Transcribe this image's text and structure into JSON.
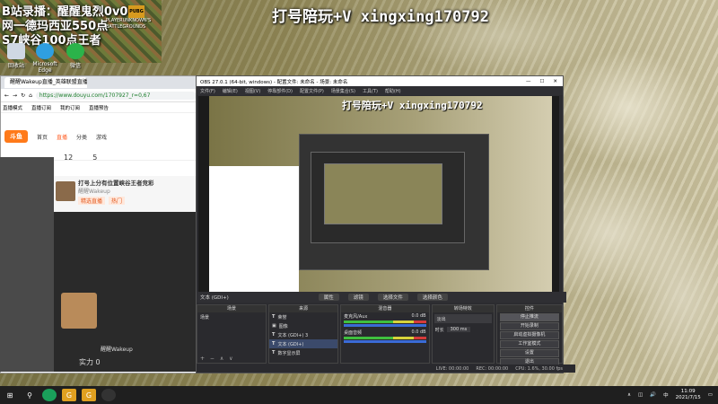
{
  "overlay": {
    "line1": "B站录播：醒醒鬼烈0v0",
    "line2": "网一德玛西亚550点",
    "line3": "S7峡谷100点王者",
    "banner": "打号陪玩+V xingxing170792"
  },
  "desktop_icons": [
    {
      "label": "回收站",
      "icon": "recycle-bin-icon"
    },
    {
      "label": "Microsoft Edge",
      "icon": "edge-icon"
    },
    {
      "label": "微信",
      "icon": "wechat-icon"
    }
  ],
  "pubg": {
    "badge": "PUBG",
    "sub1": "PLAYERUNKNOWN'S",
    "sub2": "BATTLEGROUNDS"
  },
  "browser": {
    "tab_title": "醒醒Wakeup直播_英雄联盟直播",
    "url": "https://www.douyu.com/1707927_r=0,67",
    "bookmarks": [
      "直播模式",
      "直播订阅",
      "我的订阅",
      "直播预告"
    ],
    "nav": [
      "首页",
      "直播",
      "分类",
      "游戏"
    ],
    "room_title": "打号上分有位置峡谷王者竞彩",
    "streamer": "醒醒Wakeup",
    "stats": [
      {
        "value": "12"
      },
      {
        "value": "5"
      }
    ],
    "tags": [
      "精选直播",
      "热门"
    ],
    "chat_name": "醒醒Wakeup",
    "bottom_value": "实力 0"
  },
  "obs": {
    "title": "OBS 27.0.1 (64-bit, windows) - 配置文件: 未命名 - 场景: 未命名",
    "menu": [
      "文件(F)",
      "编辑(E)",
      "视图(V)",
      "停靠部件(D)",
      "配置文件(P)",
      "场景集合(S)",
      "工具(T)",
      "帮助(H)"
    ],
    "preview_overlay": "打号陪玩+V xingxing170792",
    "source_bar": {
      "label": "文本 (GDI+)",
      "props": "属性",
      "filters": "滤镜",
      "edit": "选择文件",
      "select": "选择颜色"
    },
    "docks": {
      "scenes": {
        "title": "场景",
        "items": [
          "场景"
        ]
      },
      "sources": {
        "title": "来源",
        "items": [
          "荣誉",
          "图像",
          "文本 (GDI+) 3",
          "文本 (GDI+)",
          "数字显示屏"
        ]
      },
      "mixer": {
        "title": "混音器",
        "items": [
          {
            "name": "麦克风/Aux",
            "db": "0.0 dB"
          },
          {
            "name": "桌面音频",
            "db": "0.0 dB"
          }
        ]
      },
      "transitions": {
        "title": "转场特效",
        "type": "淡出",
        "duration_label": "时长",
        "duration": "300 ms"
      },
      "controls": {
        "title": "控件",
        "buttons": [
          "停止推流",
          "开始录制",
          "启动虚拟摄像机",
          "工作室模式",
          "设置",
          "退出"
        ]
      }
    },
    "status": {
      "live": "LIVE: 00:00:00",
      "rec": "REC: 00:00:00",
      "cpu": "CPU: 1.6%, 30.00 fps"
    }
  },
  "taskbar": {
    "time": "11:09",
    "date": "2021/7/15",
    "lang": "中"
  }
}
